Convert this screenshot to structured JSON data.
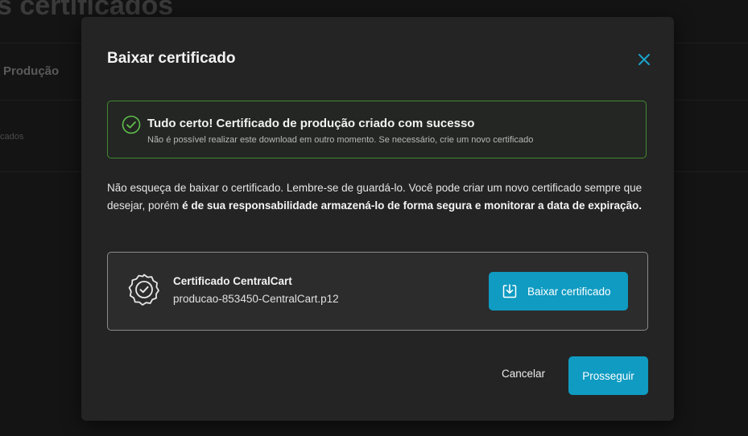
{
  "background": {
    "page_title": "s certificados",
    "tab_label": "Produção",
    "row_text": "cados"
  },
  "modal": {
    "title": "Baixar certificado",
    "close_icon": "close-icon",
    "success": {
      "icon": "check-circle-icon",
      "title": "Tudo certo! Certificado de produção criado com sucesso",
      "subtitle": "Não é possível realizar este download em outro momento. Se necessário, crie um novo certificado"
    },
    "description": {
      "text": "Não esqueça de baixar o certificado. Lembre-se de guardá-lo. Você pode criar um novo certificado sempre que desejar, porém ",
      "bold": "é de sua responsabilidade armazená-lo de forma segura e monitorar a data de expiração."
    },
    "certificate": {
      "icon": "certificate-badge-icon",
      "name": "Certificado CentralCart",
      "filename": "producao-853450-CentralCart.p12",
      "download_label": "Baixar certificado",
      "download_icon": "download-icon"
    },
    "footer": {
      "cancel_label": "Cancelar",
      "proceed_label": "Prosseguir"
    }
  },
  "colors": {
    "accent": "#0f9bc2",
    "success": "#3f8a2e",
    "modal_bg": "#242424",
    "page_bg": "#141414"
  }
}
